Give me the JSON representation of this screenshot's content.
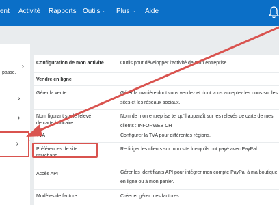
{
  "nav": {
    "items": [
      {
        "label": "ent",
        "dropdown": false
      },
      {
        "label": "Activité",
        "dropdown": false
      },
      {
        "label": "Rapports",
        "dropdown": false
      },
      {
        "label": "Outils",
        "dropdown": true
      },
      {
        "label": "Plus",
        "dropdown": true
      },
      {
        "label": "Aide",
        "dropdown": false
      }
    ],
    "bell_icon": "bell-icon"
  },
  "sidebar": {
    "item1_text": "passe,"
  },
  "sections": {
    "business_config": {
      "label": "Configuration de mon activité",
      "desc": "Outils pour développer l'activité de mon entreprise."
    },
    "online_sales": {
      "label": "Vendre en ligne"
    }
  },
  "rows": [
    {
      "label": "Gérer la vente",
      "desc": "Gérer la manière dont vous vendez et dont vous acceptez les dons sur les sites et les réseaux sociaux."
    },
    {
      "label": "Nom figurant sur le relevé de carte bancaire",
      "desc": "Nom de mon entreprise tel qu'il apparaît sur les relevés de carte de mes clients : INFORWEB CH"
    },
    {
      "label": "TVA",
      "desc": "Configurer la TVA pour différentes régions."
    },
    {
      "label": "Préférences de site marchand",
      "desc": "Rediriger les clients sur mon site lorsqu'ils ont payé avec PayPal."
    },
    {
      "label": "Accès API",
      "desc": "Gérer les identifiants API pour intégrer mon compte PayPal à ma boutique en ligne ou à mon panier."
    },
    {
      "label": "Modèles de facture",
      "desc": "Créer et gérer mes factures."
    }
  ],
  "colors": {
    "nav_bg": "#0b6fc7",
    "annotation": "#d9534f",
    "page_bg": "#e9ecee"
  }
}
